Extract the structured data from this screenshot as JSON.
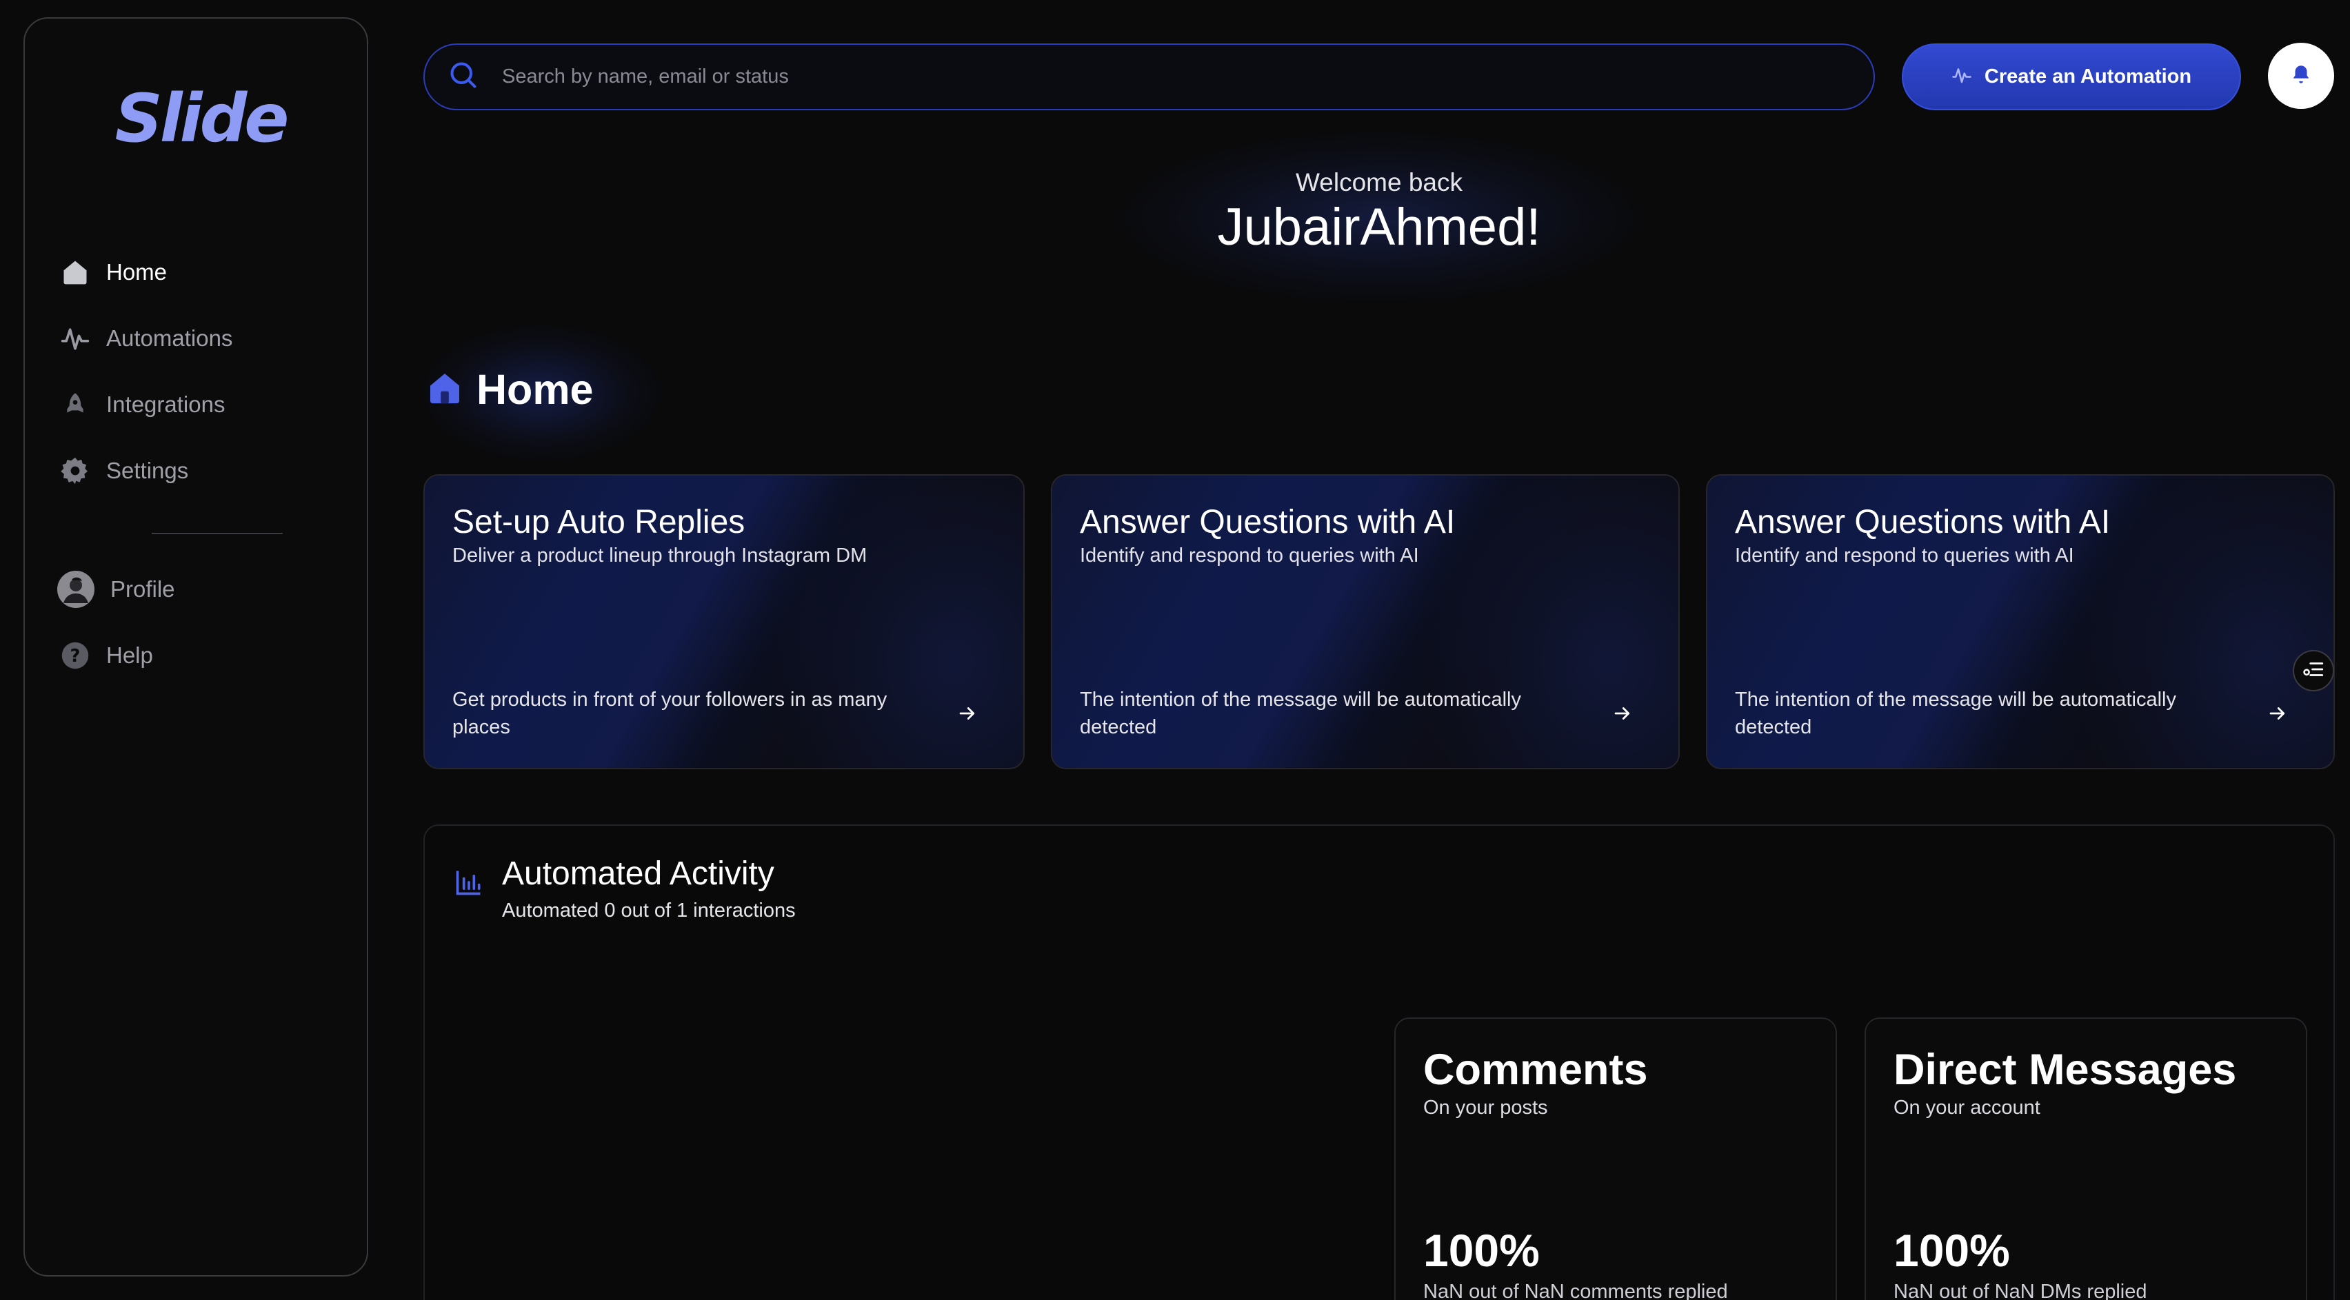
{
  "app": {
    "logo_text": "Slide"
  },
  "sidebar": {
    "items": [
      {
        "label": "Home",
        "icon": "home-icon",
        "active": true
      },
      {
        "label": "Automations",
        "icon": "activity-icon"
      },
      {
        "label": "Integrations",
        "icon": "rocket-icon"
      },
      {
        "label": "Settings",
        "icon": "gear-icon"
      }
    ],
    "secondary": [
      {
        "label": "Profile",
        "icon": "avatar"
      },
      {
        "label": "Help",
        "icon": "help-icon"
      }
    ]
  },
  "search": {
    "placeholder": "Search by name, email or status",
    "value": ""
  },
  "header": {
    "create_label": "Create an Automation"
  },
  "welcome": {
    "greeting": "Welcome back",
    "name": "JubairAhmed!"
  },
  "home": {
    "title": "Home"
  },
  "cards": [
    {
      "title": "Set-up Auto Replies",
      "subtitle": "Deliver a product lineup through Instagram DM",
      "footer": "Get products in front of your followers in as many places"
    },
    {
      "title": "Answer Questions with AI",
      "subtitle": "Identify and respond to queries with AI",
      "footer": "The intention of the message will be automatically detected"
    },
    {
      "title": "Answer Questions with AI",
      "subtitle": "Identify and respond to queries with AI",
      "footer": "The intention of the message will be automatically detected"
    }
  ],
  "activity": {
    "title": "Automated Activity",
    "subtitle": "Automated 0 out of 1 interactions",
    "stats": [
      {
        "title": "Comments",
        "subtitle": "On your posts",
        "value": "100%",
        "note": "NaN out of NaN comments replied"
      },
      {
        "title": "Direct Messages",
        "subtitle": "On your account",
        "value": "100%",
        "note": "NaN out of NaN DMs replied"
      }
    ]
  },
  "colors": {
    "accent": "#2f45cc",
    "logo": "#8f9cf5",
    "background": "#0a0a0b"
  }
}
